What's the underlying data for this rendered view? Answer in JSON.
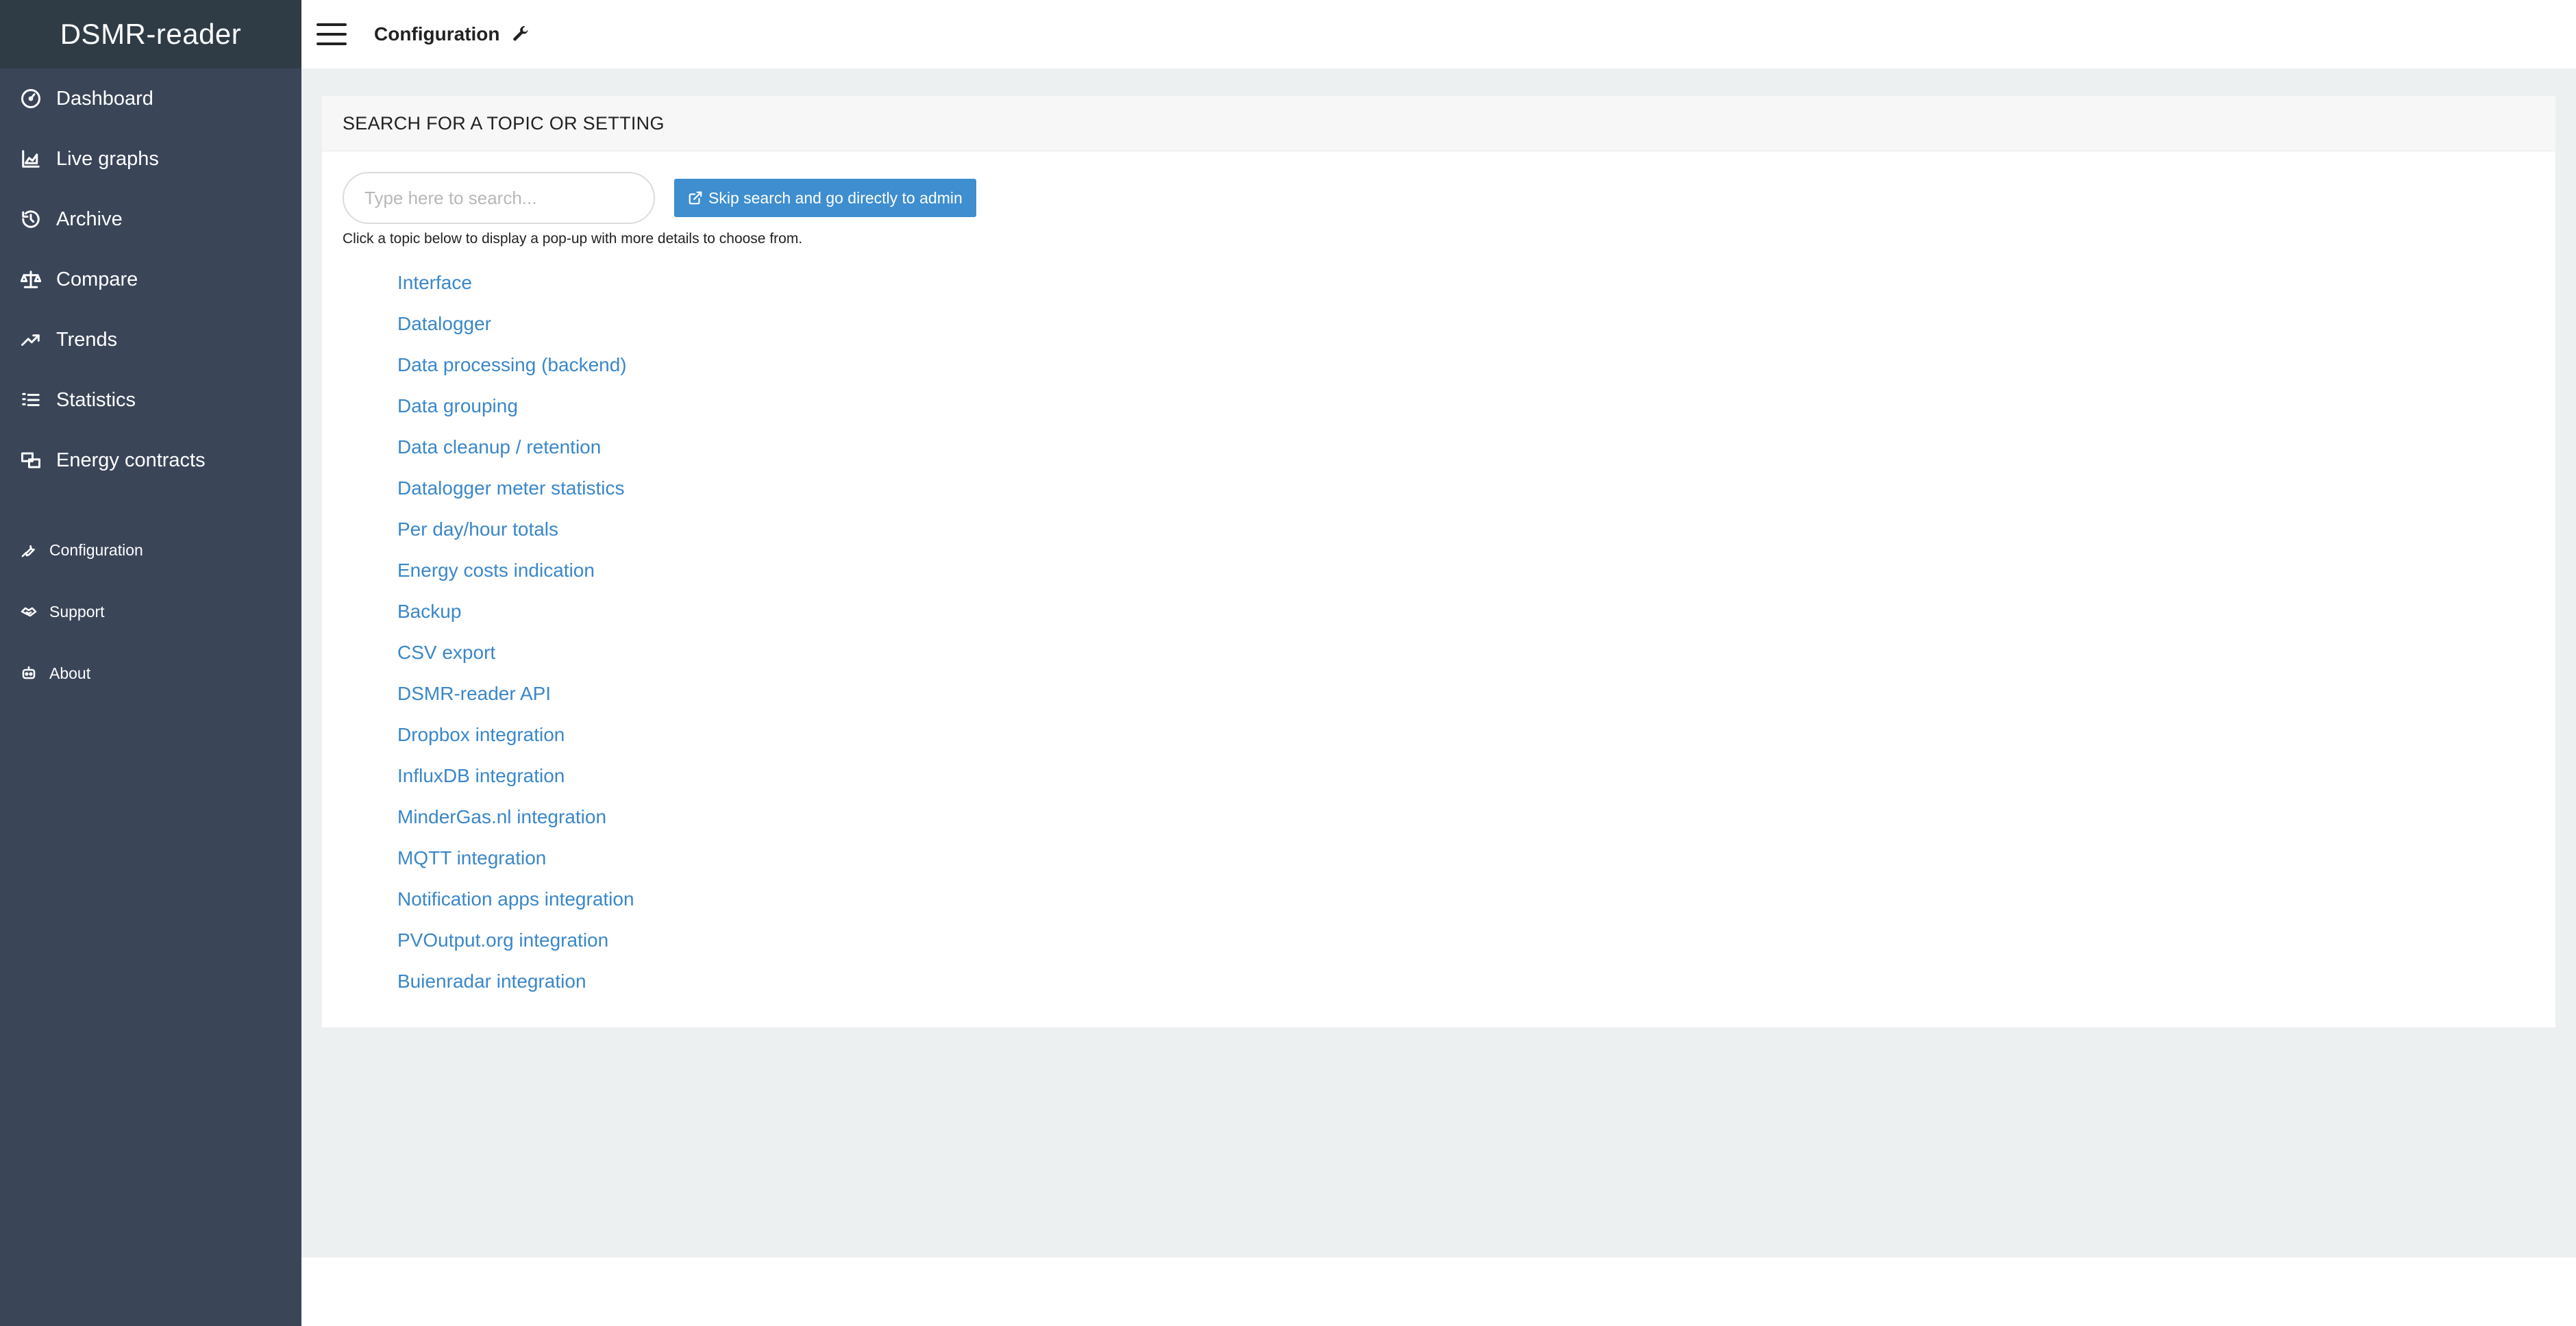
{
  "app": {
    "brand": "DSMR-reader"
  },
  "sidebar": {
    "main_items": [
      {
        "label": "Dashboard",
        "icon": "dashboard-icon"
      },
      {
        "label": "Live graphs",
        "icon": "area-chart-icon"
      },
      {
        "label": "Archive",
        "icon": "history-icon"
      },
      {
        "label": "Compare",
        "icon": "balance-scale-icon"
      },
      {
        "label": "Trends",
        "icon": "trend-up-icon"
      },
      {
        "label": "Statistics",
        "icon": "list-icon"
      },
      {
        "label": "Energy contracts",
        "icon": "contracts-icon"
      }
    ],
    "secondary_items": [
      {
        "label": "Configuration",
        "icon": "wrench-icon"
      },
      {
        "label": "Support",
        "icon": "handshake-icon"
      },
      {
        "label": "About",
        "icon": "robot-icon"
      }
    ]
  },
  "topbar": {
    "title": "Configuration"
  },
  "panel": {
    "header": "SEARCH FOR A TOPIC OR SETTING",
    "search_placeholder": "Type here to search...",
    "admin_button": "Skip search and go directly to admin",
    "hint": "Click a topic below to display a pop-up with more details to choose from.",
    "topics": [
      "Interface",
      "Datalogger",
      "Data processing (backend)",
      "Data grouping",
      "Data cleanup / retention",
      "Datalogger meter statistics",
      "Per day/hour totals",
      "Energy costs indication",
      "Backup",
      "CSV export",
      "DSMR-reader API",
      "Dropbox integration",
      "InfluxDB integration",
      "MinderGas.nl integration",
      "MQTT integration",
      "Notification apps integration",
      "PVOutput.org integration",
      "Buienradar integration"
    ]
  },
  "colors": {
    "sidebar_bg": "#3a4558",
    "brand_bg": "#2f3c46",
    "content_bg": "#ecf0f1",
    "link": "#3a87c9",
    "button": "#3e8ed0"
  }
}
